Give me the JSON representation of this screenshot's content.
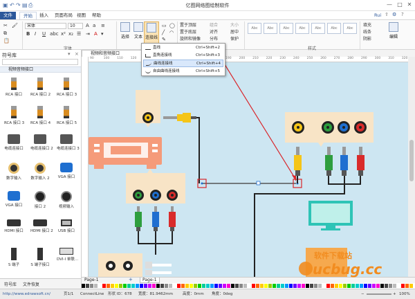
{
  "title": "亿图网络图绘制软件",
  "window": {
    "user": "Rui",
    "minimize": "—",
    "restore": "□",
    "close": "✕"
  },
  "menu": [
    "文件",
    "开始",
    "插入",
    "页面布局",
    "视图",
    "帮助"
  ],
  "ribbon": {
    "font_name": "宋体",
    "font_size": "10",
    "groups": {
      "font": "字体",
      "style": "样式"
    },
    "tools": {
      "select": "选择",
      "text": "文本",
      "connector": "连接线"
    },
    "arrange": [
      "置于顶层",
      "置于底层",
      "旋转和镜像"
    ],
    "arrange2": [
      "组合",
      "对齐",
      "分布"
    ],
    "arrange3": [
      "大小",
      "居中",
      "保护"
    ],
    "style_boxes": [
      "Abc",
      "Abc",
      "Abc",
      "Abc",
      "Abc",
      "Abc",
      "Abc"
    ],
    "fill": [
      "填充",
      "线条",
      "阴影"
    ],
    "edit": "编辑"
  },
  "connector_menu": {
    "items": [
      {
        "label": "直线",
        "shortcut": "Ctrl+Shift+2"
      },
      {
        "label": "直角连接线",
        "shortcut": "Ctrl+Shift+3"
      },
      {
        "label": "曲线连接线",
        "shortcut": "Ctrl+Shift+4"
      },
      {
        "label": "自由曲线连接线",
        "shortcut": "Ctrl+Shift+5"
      }
    ],
    "highlight_index": 2
  },
  "library": {
    "title": "符号库",
    "category": "视频音频接口",
    "symbols": [
      "RCA 接口",
      "RCA 接口 2",
      "RCA 接口 3",
      "RCA 接口 3",
      "RCA 接口 4",
      "RCA 接口 5",
      "电缆连接口",
      "电缆连接口 2",
      "电缆连接口 3",
      "数字输入",
      "数字输入 2",
      "VGA 接口",
      "VGA 接口",
      "接口 2",
      "视频输入",
      "HDMI 接口",
      "HDMI 接口 2",
      "USB 接口",
      "S 端子",
      "S 端子接口",
      "DVI-I 单联..."
    ],
    "tabs": [
      "符号库",
      "文件恢复"
    ]
  },
  "doc_tab": "视频和音频接口",
  "ruler_ticks": [
    "90",
    "100",
    "110",
    "120",
    "130",
    "140",
    "150",
    "160",
    "170",
    "180",
    "190",
    "200",
    "210",
    "220",
    "230",
    "240",
    "250",
    "260",
    "270",
    "280",
    "290",
    "300",
    "310",
    "320"
  ],
  "pages": {
    "prev": "Page-1",
    "current": "Page-1",
    "add": "+"
  },
  "status": {
    "url": "http://www.edrawsoft.cn/",
    "page": "页1/1",
    "shape": "ConnectLine",
    "id": "形状 ID：678",
    "width": "宽度：81.9462mm",
    "height": "高度：0mm",
    "angle": "角度：0deg",
    "zoom": "100%"
  },
  "watermark": {
    "brand": "ucbug.cc",
    "tagline": "软件下载站"
  },
  "colors": {
    "accent": "#2b579a",
    "canvas": "#cde6f2",
    "panel": "#f8e4c6",
    "receiver": "#f59b7a",
    "tv": "#2ec4b6",
    "cable": "#222222",
    "red_annotation": "#d9252a"
  }
}
